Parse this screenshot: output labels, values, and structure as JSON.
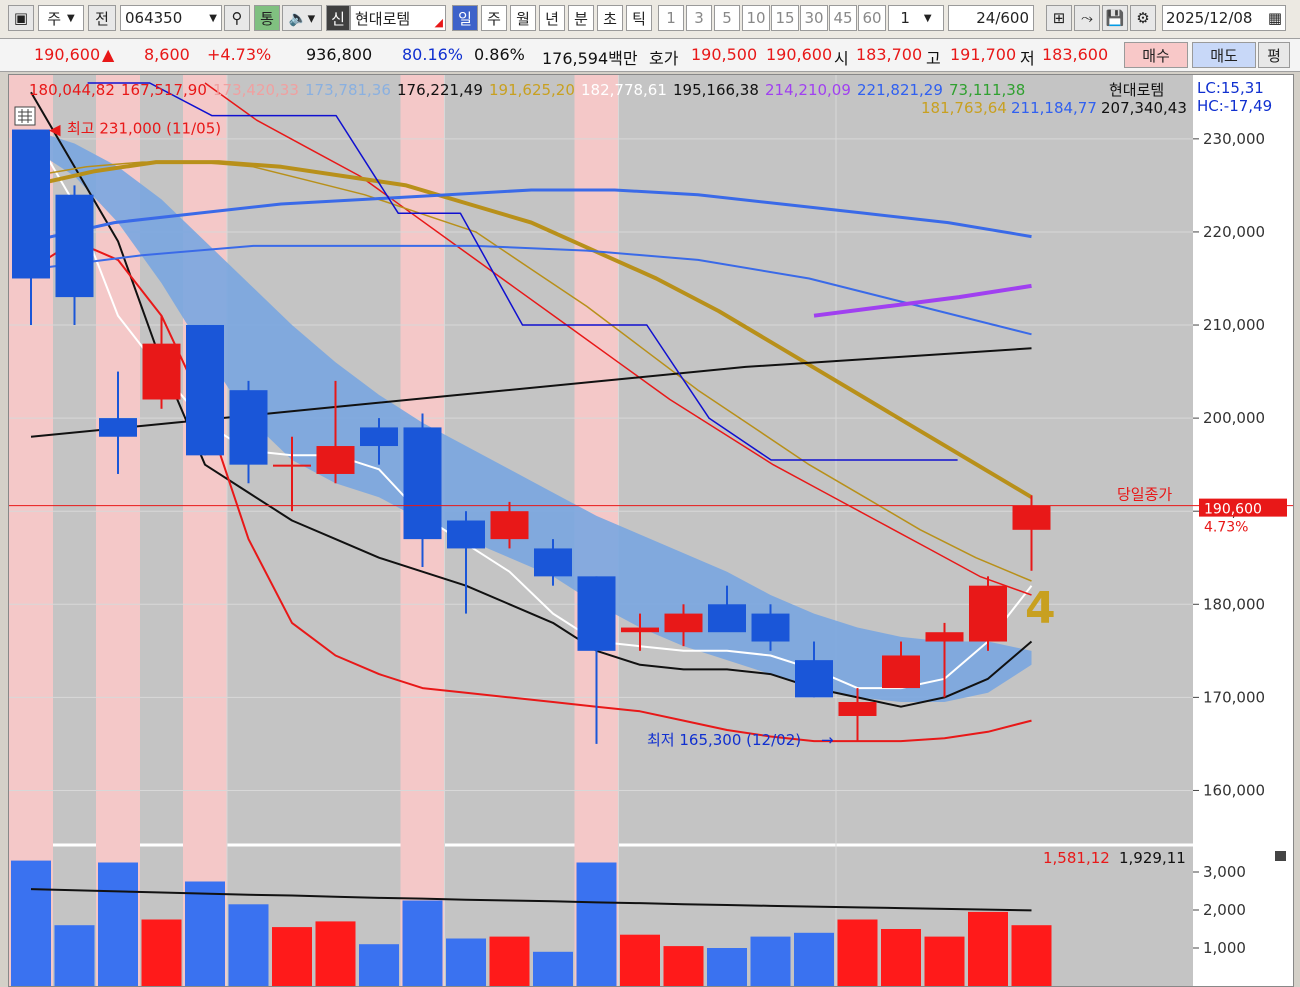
{
  "toolbar": {
    "market": "주",
    "prev": "전",
    "code": "064350",
    "tong": "통",
    "sin": "신",
    "name": "현대로템",
    "periods": [
      "일",
      "주",
      "월",
      "년",
      "분",
      "초",
      "틱"
    ],
    "intervals": [
      "1",
      "3",
      "5",
      "10",
      "15",
      "30",
      "45",
      "60"
    ],
    "multiplier": "1",
    "count": "24",
    "count_total": "/600",
    "date": "2025/12/08"
  },
  "quote": {
    "price": "190,600",
    "change_arrow": "▲",
    "change": "8,600",
    "change_pct": "+4.73%",
    "volume": "936,800",
    "vol_ratio": "80.16%",
    "turnover": "0.86%",
    "amount": "176,594백만",
    "hoga_label": "호가",
    "ask": "190,500",
    "bid": "190,600",
    "open_label": "시",
    "open": "183,700",
    "high_label": "고",
    "high": "191,700",
    "low_label": "저",
    "low": "183,600",
    "buy": "매수",
    "sell": "매도",
    "avg": "평"
  },
  "legend": {
    "values": [
      {
        "text": "180,044,82",
        "color": "#e81818"
      },
      {
        "text": "167,517,90",
        "color": "#e81818"
      },
      {
        "text": "173,420,33",
        "color": "#f0a0a0"
      },
      {
        "text": "173,781,36",
        "color": "#8ab0e0"
      },
      {
        "text": "176,221,49",
        "color": "#111111"
      },
      {
        "text": "191,625,20",
        "color": "#c8a020"
      },
      {
        "text": "182,778,61",
        "color": "#ffffff"
      },
      {
        "text": "195,166,38",
        "color": "#111111"
      },
      {
        "text": "214,210,09",
        "color": "#a040f0"
      },
      {
        "text": "221,821,29",
        "color": "#3060f0"
      },
      {
        "text": "73,111,38",
        "color": "#30a030"
      }
    ],
    "name": "현대로템",
    "lc": "LC:15,31",
    "hc": "HC:-17,49",
    "row2": [
      {
        "text": "181,763,64",
        "color": "#c8a020"
      },
      {
        "text": "211,184,77",
        "color": "#3060f0"
      },
      {
        "text": "207,340,43",
        "color": "#111111"
      }
    ]
  },
  "annotations": {
    "high": "최고 231,000 (11/05)",
    "low": "최저 165,300 (12/02)",
    "close_label": "당일종가",
    "close_price": "190,600",
    "close_pct": "4.73%",
    "wave_number": "4"
  },
  "volume_legend": {
    "v1": "1,581,12",
    "v2": "1,929,11"
  },
  "colors": {
    "up": "#e81818",
    "down": "#1a56d8",
    "band": "#7aa6e0",
    "shade": "#f4c8c8",
    "chart_bg": "#c4c4c4",
    "close_line": "#e81818"
  },
  "chart_data": {
    "type": "candlestick",
    "price_axis": {
      "min": 155000,
      "max": 236000,
      "ticks": [
        160000,
        170000,
        180000,
        190000,
        200000,
        210000,
        220000,
        230000
      ],
      "tick_labels": [
        "160,000",
        "170,000",
        "180,000",
        "190,000",
        "200,000",
        "210,000",
        "220,000",
        "230,000"
      ]
    },
    "volume_axis": {
      "min": 0,
      "max": 3500,
      "ticks": [
        1000,
        2000,
        3000
      ],
      "tick_labels": [
        "1,000",
        "2,000",
        "3,000"
      ]
    },
    "shaded_candles": [
      0,
      2,
      4,
      9,
      13
    ],
    "candles": [
      {
        "o": 231000,
        "h": 231000,
        "l": 210000,
        "c": 215000
      },
      {
        "o": 224000,
        "h": 225000,
        "l": 210000,
        "c": 213000
      },
      {
        "o": 200000,
        "h": 205000,
        "l": 194000,
        "c": 198000
      },
      {
        "o": 202000,
        "h": 211000,
        "l": 201000,
        "c": 208000
      },
      {
        "o": 210000,
        "h": 210000,
        "l": 196000,
        "c": 196000
      },
      {
        "o": 203000,
        "h": 204000,
        "l": 193000,
        "c": 195000
      },
      {
        "o": 195000,
        "h": 198000,
        "l": 190000,
        "c": 195000
      },
      {
        "o": 194000,
        "h": 204000,
        "l": 193000,
        "c": 197000
      },
      {
        "o": 199000,
        "h": 200000,
        "l": 195000,
        "c": 197000
      },
      {
        "o": 199000,
        "h": 200500,
        "l": 184000,
        "c": 187000
      },
      {
        "o": 189000,
        "h": 190000,
        "l": 179000,
        "c": 186000
      },
      {
        "o": 187000,
        "h": 191000,
        "l": 186000,
        "c": 190000
      },
      {
        "o": 186000,
        "h": 187000,
        "l": 182000,
        "c": 183000
      },
      {
        "o": 183000,
        "h": 183000,
        "l": 165000,
        "c": 175000
      },
      {
        "o": 177000,
        "h": 179000,
        "l": 175000,
        "c": 177500
      },
      {
        "o": 177000,
        "h": 180000,
        "l": 175500,
        "c": 179000
      },
      {
        "o": 180000,
        "h": 182000,
        "l": 178000,
        "c": 177000
      },
      {
        "o": 179000,
        "h": 180000,
        "l": 175000,
        "c": 176000
      },
      {
        "o": 174000,
        "h": 176000,
        "l": 170000,
        "c": 170000
      },
      {
        "o": 168000,
        "h": 171000,
        "l": 165300,
        "c": 169500
      },
      {
        "o": 171000,
        "h": 176000,
        "l": 171000,
        "c": 174500
      },
      {
        "o": 176000,
        "h": 178000,
        "l": 170000,
        "c": 177000
      },
      {
        "o": 176000,
        "h": 183000,
        "l": 175000,
        "c": 182000
      },
      {
        "o": 188000,
        "h": 191700,
        "l": 183600,
        "c": 190600
      }
    ],
    "volumes": [
      3300,
      1600,
      3250,
      1750,
      2750,
      2150,
      1550,
      1700,
      1100,
      2250,
      1250,
      1300,
      900,
      3250,
      1350,
      1050,
      1000,
      1300,
      1400,
      1750,
      1500,
      1300,
      1950,
      1600
    ],
    "volume_ma": [
      2550,
      2520,
      2490,
      2460,
      2430,
      2400,
      2380,
      2350,
      2320,
      2300,
      2270,
      2250,
      2230,
      2200,
      2180,
      2150,
      2130,
      2110,
      2090,
      2070,
      2050,
      2030,
      2010,
      1990
    ],
    "series": [
      {
        "color": "#111111",
        "width": 2,
        "values": [
          235000,
          227000,
          219000,
          206000,
          195000,
          192000,
          189000,
          187000,
          185000,
          183500,
          182000,
          180000,
          178000,
          175000,
          173500,
          173000,
          173000,
          172500,
          171000,
          170000,
          169000,
          170000,
          172000,
          176000
        ]
      },
      {
        "color": "#ffffff",
        "width": 2,
        "values": [
          231000,
          223000,
          211000,
          205000,
          199500,
          196500,
          196000,
          196000,
          194500,
          189500,
          186500,
          183500,
          179000,
          176000,
          175500,
          175000,
          175000,
          174500,
          173000,
          171000,
          171000,
          172000,
          176000,
          182000
        ]
      },
      {
        "color": "#e81818",
        "width": 2,
        "values": [
          216000,
          219000,
          217000,
          211000,
          201000,
          187000,
          178000,
          174500,
          172500,
          171000,
          170500,
          170000,
          169500,
          169000,
          168500,
          167500,
          166500,
          165800,
          165300,
          165300,
          165300,
          165600,
          166300,
          167500
        ]
      },
      {
        "color": "#e81818",
        "width": 1.5,
        "values": [
          236000,
          232000,
          229000,
          226000,
          222000,
          218000,
          214000,
          210000,
          206000,
          202000,
          198500,
          195000,
          192000,
          189000,
          186000,
          183000,
          181000
        ]
      },
      {
        "color": "#b8901a",
        "width": 1.5,
        "values": [
          226000,
          227000,
          227500,
          227500,
          227000,
          225500,
          224000,
          222000,
          220000,
          216000,
          212000,
          207500,
          203000,
          199000,
          195000,
          191500,
          188000,
          185000,
          182500
        ]
      },
      {
        "color": "#b8901a",
        "width": 4,
        "values": [
          225000,
          226500,
          227500,
          227500,
          227000,
          226000,
          225000,
          223000,
          221000,
          218000,
          215000,
          211500,
          207500,
          203500,
          199500,
          195500,
          191500
        ]
      },
      {
        "color": "#3a6ae8",
        "width": 3,
        "values": [
          219000,
          221000,
          222000,
          223000,
          223500,
          224000,
          224500,
          224500,
          224000,
          223000,
          222000,
          221000,
          219500
        ]
      },
      {
        "color": "#3a6ae8",
        "width": 2,
        "values": [
          216000,
          217500,
          218500,
          218500,
          218500,
          218000,
          217000,
          215000,
          212000,
          209000
        ]
      },
      {
        "color": "#111111",
        "width": 2,
        "values": [
          198000,
          199500,
          201000,
          202500,
          204000,
          205500,
          206500,
          207500
        ]
      },
      {
        "color": "#a040f0",
        "width": 4,
        "values": [
          211000,
          212000,
          213000,
          214200
        ]
      },
      {
        "color": "#1010d0",
        "width": 1.5,
        "values": [
          236000,
          236000,
          232500,
          232500,
          232500,
          222000,
          222000,
          210000,
          210000,
          210000,
          200000,
          195500,
          195500,
          195500,
          195500
        ]
      }
    ]
  }
}
